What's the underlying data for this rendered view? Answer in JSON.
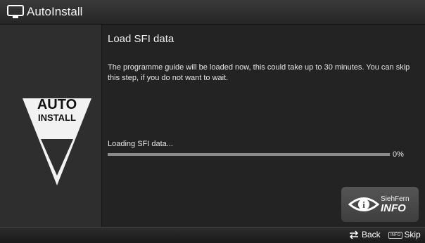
{
  "header": {
    "title": "AutoInstall",
    "icon": "tv-icon"
  },
  "sidebar": {
    "logo_line1": "AUTO",
    "logo_line2": "INSTALL",
    "icon": "auto-install-logo"
  },
  "main": {
    "heading": "Load SFI data",
    "description": "The programme guide will be loaded now, this could take up to 30 minutes. You can skip this step, if you do not want to wait.",
    "loading_label": "Loading SFI data...",
    "progress_fraction": 0,
    "progress_text": "0%",
    "brand": {
      "line1": "SiehFern",
      "line2": "INFO",
      "icon": "siehfern-info-logo"
    }
  },
  "footer": {
    "back_label": "Back",
    "back_icon": "back-arrows-icon",
    "skip_key": "INFO",
    "skip_label": "Skip"
  },
  "colors": {
    "background": "#232323",
    "panel": "#2e2e2e",
    "progress_track": "#8a8a8a"
  }
}
